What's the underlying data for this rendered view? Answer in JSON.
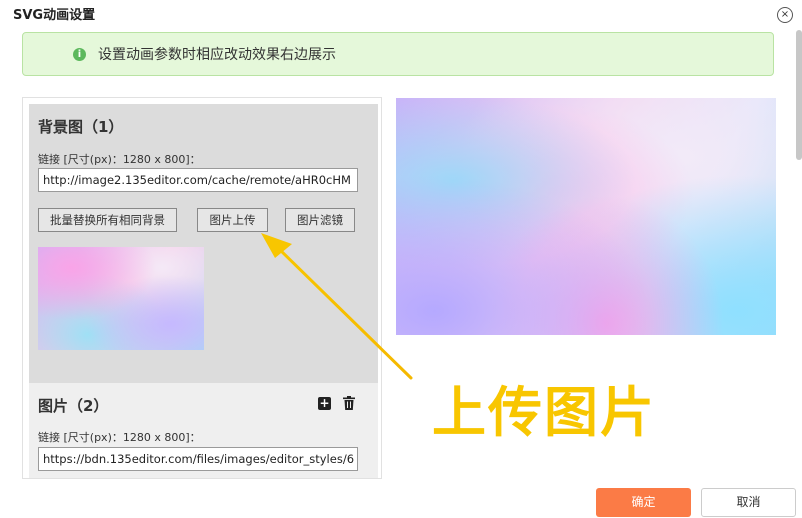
{
  "dialog": {
    "title": "SVG动画设置",
    "close_symbol": "×"
  },
  "alert": {
    "icon": "info-icon",
    "icon_glyph": "i",
    "text": "设置动画参数时相应改动效果右边展示"
  },
  "background_section": {
    "title": "背景图（1）",
    "link_label": "链接 [尺寸(px)：1280 x 800]：",
    "url": "http://image2.135editor.com/cache/remote/aHR0cHM",
    "buttons": {
      "batch_replace": "批量替换所有相同背景",
      "upload": "图片上传",
      "filter": "图片滤镜"
    }
  },
  "image_section": {
    "title": "图片（2）",
    "link_label": "链接 [尺寸(px)：1280 x 800]：",
    "url": "https://bdn.135editor.com/files/images/editor_styles/6",
    "add_icon": "plus-square-icon",
    "delete_icon": "trash-icon"
  },
  "annotation": {
    "text": "上传图片",
    "color": "#f8c600"
  },
  "footer": {
    "ok_label": "确定",
    "cancel_label": "取消"
  },
  "colors": {
    "ok_button": "#fb7b46",
    "alert_bg": "#e5f8da",
    "alert_icon": "#5cb85c"
  }
}
